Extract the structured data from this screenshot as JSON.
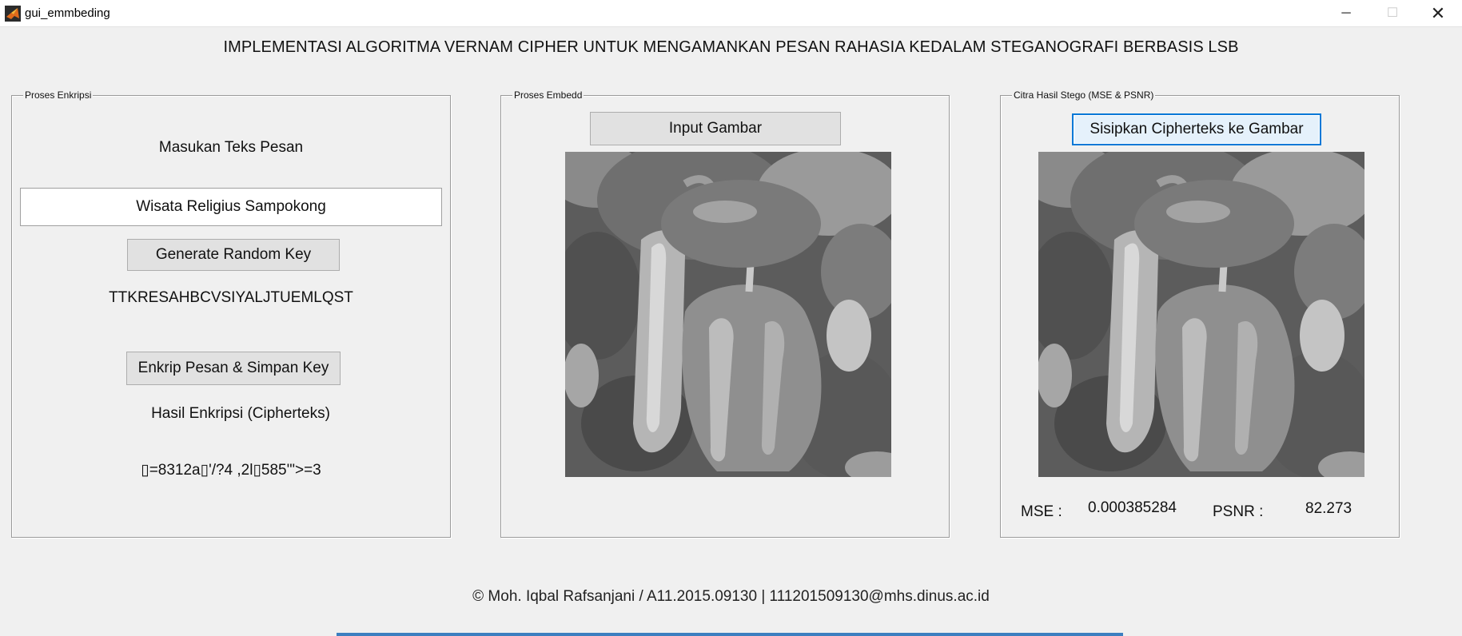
{
  "window": {
    "title": "gui_emmbeding",
    "minimize_glyph": "─",
    "maximize_glyph": "☐",
    "close_glyph": "✕",
    "app_icon": "matlab-icon"
  },
  "heading": "IMPLEMENTASI ALGORITMA VERNAM CIPHER UNTUK MENGAMANKAN PESAN RAHASIA KEDALAM STEGANOGRAFI BERBASIS LSB",
  "encrypt_panel": {
    "legend": "Proses Enkripsi",
    "message_label": "Masukan Teks Pesan",
    "message_value": "Wisata Religius Sampokong",
    "generate_button": "Generate Random Key",
    "key_value": "TTKRESAHBCVSIYALJTUEMLQST",
    "encrypt_button": "Enkrip Pesan & Simpan Key",
    "result_label": "Hasil Enkripsi (Cipherteks)",
    "ciphertext": "▯=8312a▯'/?4 ,2l▯585'\">=3"
  },
  "embed_panel": {
    "legend": "Proses Embedd",
    "input_button": "Input Gambar",
    "image_name": "peppers-grayscale-image"
  },
  "stego_panel": {
    "legend": "Citra Hasil Stego (MSE & PSNR)",
    "embed_button": "Sisipkan Cipherteks ke Gambar",
    "image_name": "peppers-grayscale-image",
    "mse_label": "MSE :",
    "mse_value": "0.000385284",
    "psnr_label": "PSNR :",
    "psnr_value": "82.273"
  },
  "footer": "© Moh. Iqbal Rafsanjani / A11.2015.09130  | 111201509130@mhs.dinus.ac.id",
  "colors": {
    "background": "#f0f0f0",
    "focus_border": "#0078d7",
    "taskbar_accent": "#3c7fc0"
  }
}
